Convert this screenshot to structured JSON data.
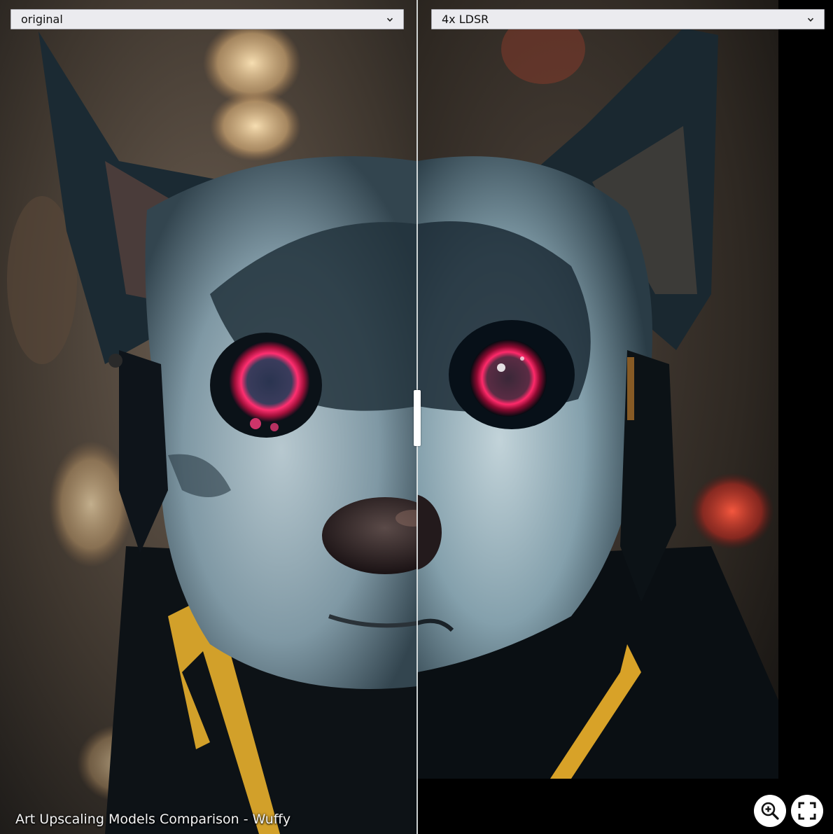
{
  "left_select": {
    "value": "original"
  },
  "right_select": {
    "value": "4x LDSR"
  },
  "caption": "Art Upscaling Models Comparison - Wuffy",
  "controls": {
    "zoom_icon": "zoom-in-icon",
    "fullscreen_icon": "fullscreen-icon"
  },
  "colors": {
    "fur": "#5c7a8a",
    "eye": "#e8205a",
    "collar": "#d8a020",
    "background_warm": "#7a5a3a"
  }
}
